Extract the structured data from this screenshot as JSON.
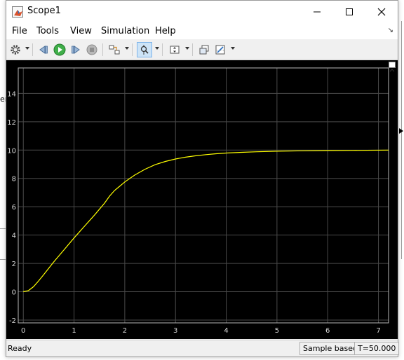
{
  "window": {
    "title": "Scope1"
  },
  "menu": [
    "File",
    "Tools",
    "View",
    "Simulation",
    "Help"
  ],
  "status": {
    "left": "Ready",
    "mode": "Sample based",
    "time": "T=50.000"
  },
  "background": {
    "clipped_text": "er"
  },
  "colors": {
    "plot_bg": "#000000",
    "grid": "#4a4a4a",
    "axes": "#b8b8b8",
    "line": "#ffff00",
    "tick_text": "#d8d8d8"
  },
  "icons": [
    "settings-icon",
    "step-back-icon",
    "run-icon",
    "step-forward-icon",
    "stop-icon",
    "highlight-block-icon",
    "zoom-icon",
    "autoscale-icon",
    "restore-icon",
    "cursor-icon"
  ],
  "chart_data": {
    "type": "line",
    "title": "",
    "xlabel": "",
    "ylabel": "",
    "xlim": [
      -0.1,
      7.2
    ],
    "ylim": [
      -2.2,
      15.8
    ],
    "xticks": [
      0,
      1,
      2,
      3,
      4,
      5,
      6,
      7
    ],
    "yticks": [
      -2,
      0,
      2,
      4,
      6,
      8,
      10,
      12,
      14
    ],
    "grid": true,
    "series": [
      {
        "x": [
          0,
          0.1,
          0.2,
          0.3,
          0.4,
          0.5,
          0.6,
          0.8,
          1.0,
          1.2,
          1.4,
          1.6,
          1.7,
          1.8,
          1.9,
          2.0,
          2.1,
          2.2,
          2.4,
          2.6,
          2.8,
          3.0,
          3.2,
          3.4,
          3.6,
          3.8,
          4.0,
          4.3,
          4.6,
          5.0,
          5.5,
          6.0,
          6.5,
          7.2
        ],
        "y": [
          0,
          0.08,
          0.35,
          0.75,
          1.2,
          1.65,
          2.1,
          2.95,
          3.8,
          4.6,
          5.4,
          6.25,
          6.75,
          7.15,
          7.45,
          7.75,
          8.0,
          8.25,
          8.65,
          8.97,
          9.2,
          9.37,
          9.5,
          9.6,
          9.68,
          9.74,
          9.79,
          9.84,
          9.88,
          9.92,
          9.95,
          9.97,
          9.98,
          10.0
        ]
      }
    ]
  }
}
